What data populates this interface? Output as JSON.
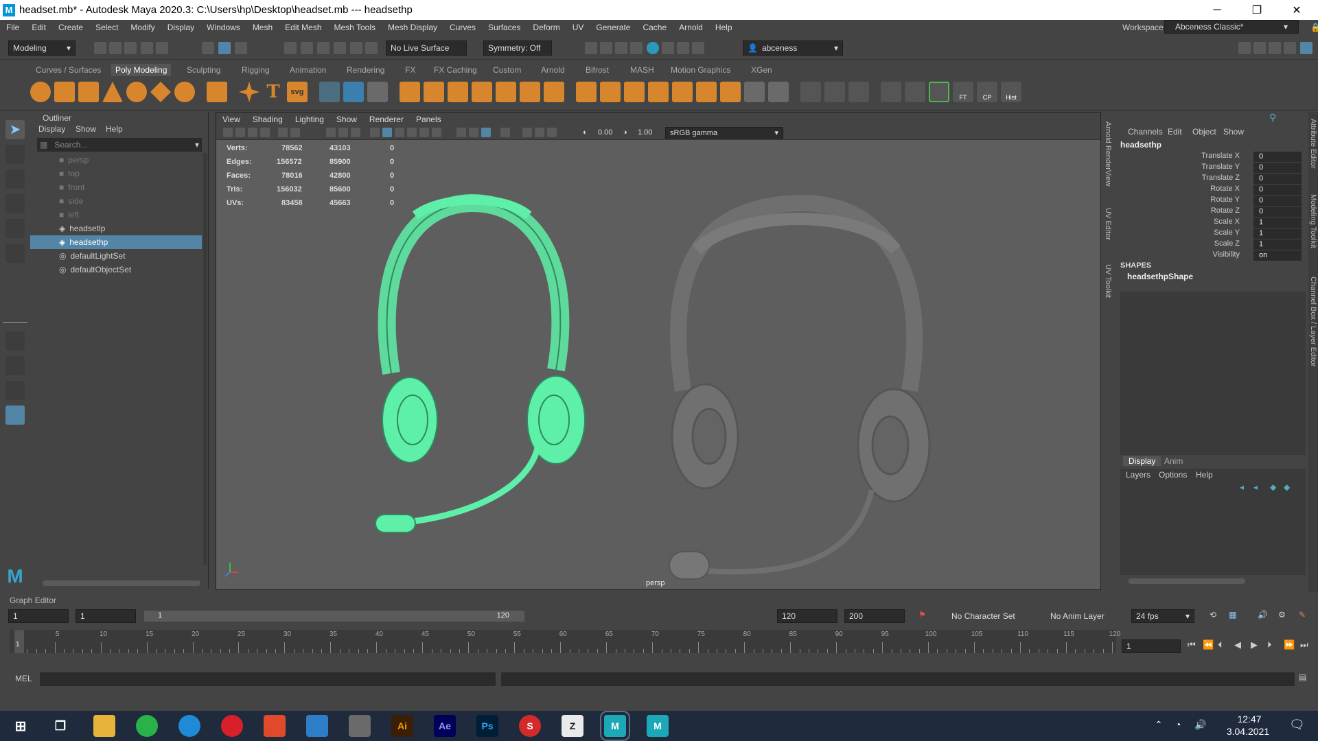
{
  "window": {
    "title": "headset.mb* - Autodesk Maya 2020.3: C:\\Users\\hp\\Desktop\\headset.mb   ---   headsethp",
    "minimize": "─",
    "restore": "❐",
    "close": "✕"
  },
  "menu": [
    "File",
    "Edit",
    "Create",
    "Select",
    "Modify",
    "Display",
    "Windows",
    "Mesh",
    "Edit Mesh",
    "Mesh Tools",
    "Mesh Display",
    "Curves",
    "Surfaces",
    "Deform",
    "UV",
    "Generate",
    "Cache",
    "Arnold",
    "Help"
  ],
  "workspace": {
    "label": "Workspace :",
    "value": "Abceness Classic*"
  },
  "status": {
    "mode": "Modeling",
    "live_surface": "No Live Surface",
    "symmetry": "Symmetry: Off",
    "user": "abceness"
  },
  "shelf_tabs": [
    "Curves / Surfaces",
    "Poly Modeling",
    "Sculpting",
    "Rigging",
    "Animation",
    "Rendering",
    "FX",
    "FX Caching",
    "Custom",
    "Arnold",
    "Bifrost",
    "MASH",
    "Motion Graphics",
    "XGen"
  ],
  "shelf_labels": {
    "ft": "FT",
    "cp": "CP",
    "hist": "Hist",
    "svg": "svg"
  },
  "outliner": {
    "title": "Outliner",
    "menu": [
      "Display",
      "Show",
      "Help"
    ],
    "search": "Search...",
    "items": [
      "persp",
      "top",
      "front",
      "side",
      "left",
      "headsetlp",
      "headsethp",
      "defaultLightSet",
      "defaultObjectSet"
    ],
    "selected": "headsethp"
  },
  "viewport": {
    "menu": [
      "View",
      "Shading",
      "Lighting",
      "Show",
      "Renderer",
      "Panels"
    ],
    "exposure": "0.00",
    "gamma": "1.00",
    "colorspace": "sRGB gamma",
    "camera": "persp",
    "hud": [
      {
        "label": "Verts:",
        "a": "78562",
        "b": "43103",
        "c": "0"
      },
      {
        "label": "Edges:",
        "a": "156572",
        "b": "85900",
        "c": "0"
      },
      {
        "label": "Faces:",
        "a": "78016",
        "b": "42800",
        "c": "0"
      },
      {
        "label": "Tris:",
        "a": "156032",
        "b": "85600",
        "c": "0"
      },
      {
        "label": "UVs:",
        "a": "83458",
        "b": "45663",
        "c": "0"
      }
    ]
  },
  "side_tabs": {
    "arnold": "Arnold RenderView",
    "uv_editor": "UV Editor",
    "uv_toolkit": "UV Toolkit",
    "attr": "Attribute Editor",
    "modeling": "Modeling Toolkit",
    "channel": "Channel Box / Layer Editor"
  },
  "channelbox": {
    "menu": [
      "Channels",
      "Edit",
      "Object",
      "Show"
    ],
    "object": "headsethp",
    "channels": [
      {
        "n": "Translate X",
        "v": "0"
      },
      {
        "n": "Translate Y",
        "v": "0"
      },
      {
        "n": "Translate Z",
        "v": "0"
      },
      {
        "n": "Rotate X",
        "v": "0"
      },
      {
        "n": "Rotate Y",
        "v": "0"
      },
      {
        "n": "Rotate Z",
        "v": "0"
      },
      {
        "n": "Scale X",
        "v": "1"
      },
      {
        "n": "Scale Y",
        "v": "1"
      },
      {
        "n": "Scale Z",
        "v": "1"
      },
      {
        "n": "Visibility",
        "v": "on"
      }
    ],
    "shapes_label": "SHAPES",
    "shape": "headsethpShape",
    "layer_tabs": [
      "Display",
      "Anim"
    ],
    "layer_menu": [
      "Layers",
      "Options",
      "Help"
    ]
  },
  "graph_editor": "Graph Editor",
  "range": {
    "start": "1",
    "start2": "1",
    "slider_start": "1",
    "slider_end": "120",
    "end": "120",
    "end2": "200",
    "char_set": "No Character Set",
    "anim_layer": "No Anim Layer",
    "fps": "24 fps",
    "current": "1"
  },
  "ticks": [
    "5",
    "10",
    "15",
    "20",
    "25",
    "30",
    "35",
    "40",
    "45",
    "50",
    "55",
    "60",
    "65",
    "70",
    "75",
    "80",
    "85",
    "90",
    "95",
    "100",
    "105",
    "110",
    "115",
    "120"
  ],
  "mel": "MEL",
  "taskbar": {
    "time": "12:47",
    "date": "3.04.2021"
  }
}
